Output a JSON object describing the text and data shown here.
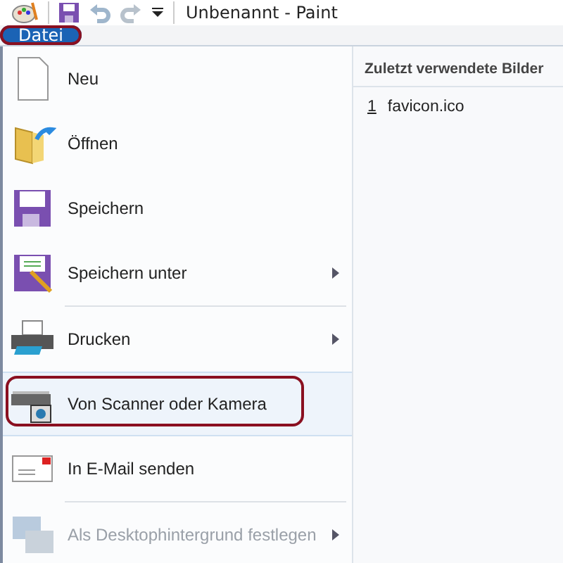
{
  "window": {
    "title": "Unbenannt - Paint"
  },
  "file_tab": {
    "label": "Datei",
    "selected": true
  },
  "menu": [
    {
      "kind": "new",
      "label": "Neu",
      "submenu": false,
      "selected": false,
      "disabled": false
    },
    {
      "kind": "open",
      "label": "Öffnen",
      "submenu": false,
      "selected": false,
      "disabled": false
    },
    {
      "kind": "save",
      "label": "Speichern",
      "submenu": false,
      "selected": false,
      "disabled": false
    },
    {
      "kind": "saveas",
      "label": "Speichern unter",
      "submenu": true,
      "selected": false,
      "disabled": false
    },
    {
      "kind": "separator"
    },
    {
      "kind": "print",
      "label": "Drucken",
      "submenu": true,
      "selected": false,
      "disabled": false
    },
    {
      "kind": "scanner",
      "label": "Von Scanner oder Kamera",
      "submenu": false,
      "selected": true,
      "disabled": false
    },
    {
      "kind": "mail",
      "label": "In E-Mail senden",
      "submenu": false,
      "selected": false,
      "disabled": false
    },
    {
      "kind": "separator"
    },
    {
      "kind": "desktop",
      "label": "Als Desktophintergrund festlegen",
      "submenu": true,
      "selected": false,
      "disabled": true
    }
  ],
  "recent": {
    "title": "Zuletzt verwendete Bilder",
    "items": [
      {
        "number": "1",
        "name": "favicon.ico"
      }
    ]
  }
}
